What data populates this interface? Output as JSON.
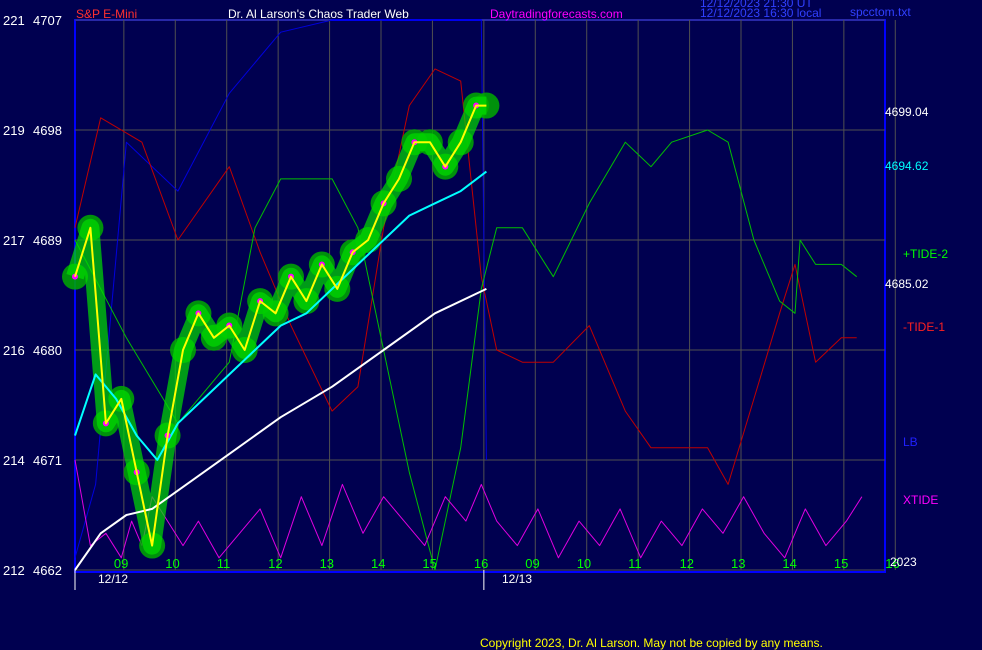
{
  "header": {
    "symbol": "S&P E-Mini",
    "title": "Dr. Al Larson's Chaos Trader Web",
    "site": "Daytradingforecasts.com",
    "timestamp_1": "12/12/2023 21:30 UT",
    "timestamp_2": "12/12/2023 16:30 local",
    "file": "spcctom.txt"
  },
  "footer": {
    "copyright": "Copyright 2023, Dr. Al Larson. May not be copied by any means."
  },
  "colors": {
    "background": "#000050",
    "frame": "#0000ff",
    "grid": "#505050",
    "axis_text": "#ffffff",
    "price_fast": "#ffff00",
    "price_slow": "#00ffff",
    "ma_long": "#ffffff",
    "tide2": "#00c000",
    "tide1": "#c00000",
    "lb": "#0000dd",
    "xtide": "#e000e0",
    "glow": "#00aa00",
    "magenta_dot": "#ff00ff"
  },
  "chart_data": {
    "type": "line",
    "title": "S&P E-Mini",
    "ylim_price": [
      4662,
      4707
    ],
    "y_ticks_price": [
      4662,
      4671,
      4680,
      4689,
      4698,
      4707
    ],
    "y_ticks_aux": [
      212,
      214,
      216,
      217,
      219,
      221
    ],
    "x_tick_labels": [
      "09",
      "10",
      "11",
      "12",
      "13",
      "14",
      "15",
      "16",
      "09",
      "10",
      "11",
      "12",
      "13",
      "14",
      "15",
      "16"
    ],
    "x_date_labels": [
      "12/12",
      "12/13"
    ],
    "year_label": "2023",
    "right_labels": {
      "last_price": "4699.04",
      "cyan_value": "4694.62",
      "white_value": "4685.02",
      "tide2": "+TIDE-2",
      "tide1": "-TIDE-1",
      "lb": "LB",
      "xtide": "XTIDE"
    },
    "series": [
      {
        "name": "price",
        "x": [
          0,
          0.3,
          0.6,
          0.9,
          1.2,
          1.5,
          1.8,
          2.1,
          2.4,
          2.7,
          3.0,
          3.3,
          3.6,
          3.9,
          4.2,
          4.5,
          4.8,
          5.1,
          5.4,
          5.7,
          6.0,
          6.3,
          6.6,
          6.9,
          7.2,
          7.5,
          7.8,
          8.0
        ],
        "values": [
          4686,
          4690,
          4674,
          4676,
          4670,
          4664,
          4673,
          4680,
          4683,
          4681,
          4682,
          4680,
          4684,
          4683,
          4686,
          4684,
          4687,
          4685,
          4688,
          4689,
          4692,
          4694,
          4697,
          4697,
          4695,
          4697,
          4700,
          4700
        ]
      },
      {
        "name": "cyan",
        "x": [
          0,
          0.4,
          0.8,
          1.2,
          1.6,
          2.0,
          2.5,
          3.0,
          3.5,
          4.0,
          4.5,
          5.0,
          5.5,
          6.0,
          6.5,
          7.0,
          7.5,
          8.0
        ],
        "values": [
          4673,
          4678,
          4676,
          4673,
          4671,
          4674,
          4676,
          4678,
          4680,
          4682,
          4683,
          4685,
          4687,
          4689,
          4691,
          4692,
          4693,
          4694.6
        ]
      },
      {
        "name": "white",
        "x": [
          0,
          0.5,
          1.0,
          1.5,
          2.0,
          3.0,
          4.0,
          5.0,
          6.0,
          7.0,
          8.0
        ],
        "values": [
          4662,
          4665,
          4666.5,
          4667,
          4668.5,
          4671.5,
          4674.5,
          4677,
          4680,
          4683,
          4685
        ]
      },
      {
        "name": "+TIDE-2",
        "x": [
          0,
          1,
          2,
          3,
          3.5,
          4,
          5,
          5.5,
          6,
          6.5,
          7,
          7.5,
          7.9,
          8.2,
          8.7,
          9.3,
          10.0,
          10.7,
          11.2,
          11.6,
          12.3,
          12.7,
          13.2,
          13.7,
          14.0,
          14.1,
          14.4,
          14.9,
          15.2
        ],
        "values": [
          4689,
          4681,
          4674,
          4679,
          4690,
          4694,
          4694,
          4690,
          4680,
          4670,
          4662,
          4672,
          4685,
          4690,
          4690,
          4686,
          4692,
          4697,
          4695,
          4697,
          4698,
          4697,
          4689,
          4684,
          4683,
          4689,
          4687,
          4687,
          4686
        ]
      },
      {
        "name": "-TIDE-1",
        "x": [
          0,
          0.5,
          1.3,
          2.0,
          3.0,
          3.6,
          4.2,
          5.0,
          5.5,
          6.0,
          6.5,
          7.0,
          7.5,
          7.9,
          8.2,
          8.7,
          9.3,
          10.0,
          10.7,
          11.2,
          11.6,
          12.3,
          12.7,
          13.2,
          13.7,
          14.0,
          14.4,
          14.9,
          15.2
        ],
        "values": [
          4690,
          4699,
          4697,
          4689,
          4695,
          4688,
          4682,
          4675,
          4677,
          4690,
          4700,
          4703,
          4702,
          4686,
          4680,
          4679,
          4679,
          4682,
          4675,
          4672,
          4672,
          4672,
          4669,
          4676,
          4683,
          4687,
          4679,
          4681,
          4681
        ]
      },
      {
        "name": "LB",
        "x": [
          0,
          0.4,
          1.0,
          2.0,
          3.0,
          4.0,
          5.0,
          6.0,
          7.0,
          7.9,
          8.0
        ],
        "values": [
          4663,
          4669,
          4697,
          4693,
          4701,
          4706,
          4707,
          4707,
          4707,
          4707,
          4671
        ]
      },
      {
        "name": "XTIDE",
        "x": [
          0,
          0.3,
          0.6,
          0.9,
          1.1,
          1.3,
          1.5,
          1.8,
          2.1,
          2.4,
          2.8,
          3.2,
          3.6,
          4.0,
          4.4,
          4.8,
          5.2,
          5.6,
          6.0,
          6.4,
          6.8,
          7.2,
          7.6,
          7.9,
          8.2,
          8.6,
          9.0,
          9.4,
          9.8,
          10.2,
          10.6,
          11.0,
          11.4,
          11.8,
          12.2,
          12.6,
          13.0,
          13.4,
          13.8,
          14.2,
          14.6,
          15.0,
          15.3
        ],
        "values": [
          4671,
          4664,
          4665,
          4663,
          4666,
          4664,
          4668,
          4666,
          4664,
          4666,
          4663,
          4665,
          4667,
          4663,
          4668,
          4664,
          4669,
          4665,
          4668,
          4666,
          4664,
          4668,
          4666,
          4669,
          4666,
          4664,
          4667,
          4663,
          4666,
          4664,
          4667,
          4663,
          4666,
          4664,
          4667,
          4665,
          4668,
          4665,
          4663,
          4667,
          4664,
          4666,
          4668
        ]
      }
    ]
  }
}
